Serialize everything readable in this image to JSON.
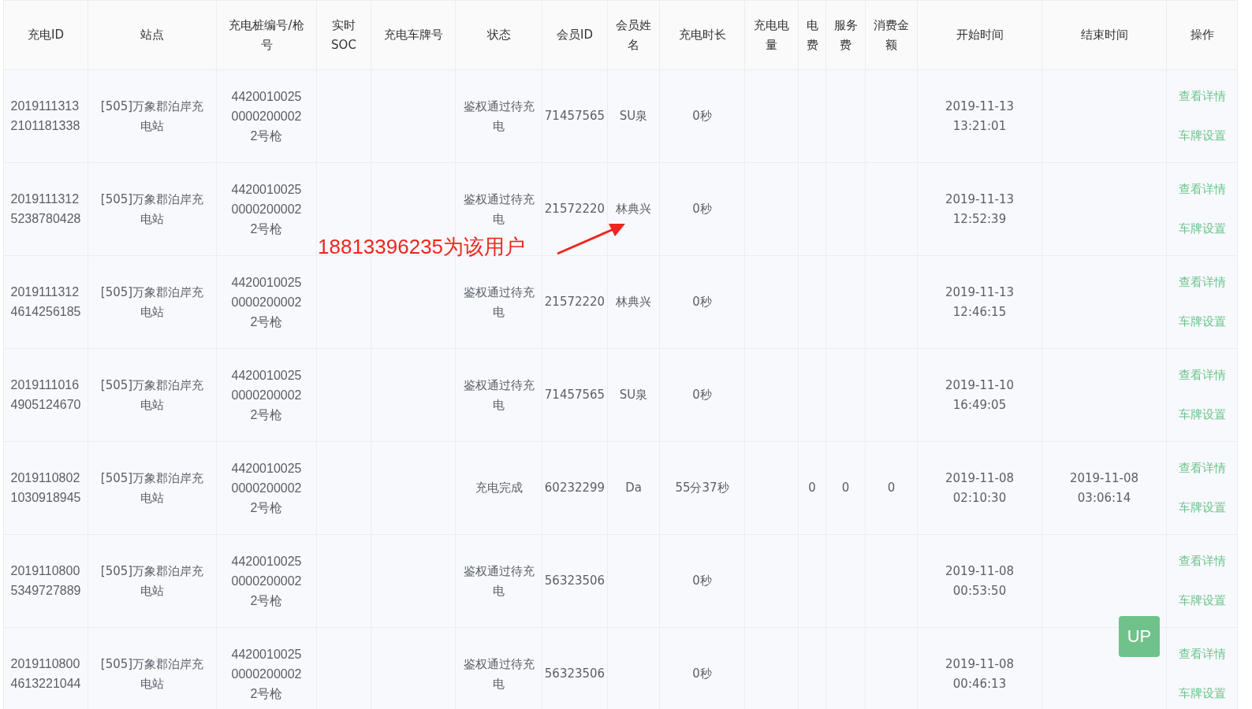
{
  "table": {
    "columns": [
      "充电ID",
      "站点",
      "充电桩编号/枪号",
      "实时SOC",
      "充电车牌号",
      "状态",
      "会员ID",
      "会员姓名",
      "充电时长",
      "充电电量",
      "电费",
      "服务费",
      "消费金额",
      "开始时间",
      "结束时间",
      "操作"
    ],
    "rows": [
      {
        "charge_id": "20191113132101181338",
        "station": "[505]万象郡泊岸充电站",
        "pile": "44200100250000200002 2号枪",
        "status": "鉴权通过待充电",
        "member_id": "71457565",
        "member_name": "SU泉",
        "duration": "0秒",
        "start_time": "2019-11-13 13:21:01",
        "actions": [
          "查看详情",
          "车牌设置"
        ]
      },
      {
        "charge_id": "20191113125238780428",
        "station": "[505]万象郡泊岸充电站",
        "pile": "44200100250000200002 2号枪",
        "status": "鉴权通过待充电",
        "member_id": "21572220",
        "member_name": "林典兴",
        "duration": "0秒",
        "start_time": "2019-11-13 12:52:39",
        "actions": [
          "查看详情",
          "车牌设置"
        ]
      },
      {
        "charge_id": "20191113124614256185",
        "station": "[505]万象郡泊岸充电站",
        "pile": "44200100250000200002 2号枪",
        "status": "鉴权通过待充电",
        "member_id": "21572220",
        "member_name": "林典兴",
        "duration": "0秒",
        "start_time": "2019-11-13 12:46:15",
        "actions": [
          "查看详情",
          "车牌设置"
        ]
      },
      {
        "charge_id": "20191110164905124670",
        "station": "[505]万象郡泊岸充电站",
        "pile": "44200100250000200002 2号枪",
        "status": "鉴权通过待充电",
        "member_id": "71457565",
        "member_name": "SU泉",
        "duration": "0秒",
        "start_time": "2019-11-10 16:49:05",
        "actions": [
          "查看详情",
          "车牌设置"
        ]
      },
      {
        "charge_id": "20191108021030918945",
        "station": "[505]万象郡泊岸充电站",
        "pile": "44200100250000200002 2号枪",
        "status": "充电完成",
        "member_id": "60232299",
        "member_name": "Da",
        "duration": "55分37秒",
        "power_fee": "0",
        "service_fee": "0",
        "amount": "0",
        "start_time": "2019-11-08 02:10:30",
        "end_time": "2019-11-08 03:06:14",
        "actions": [
          "查看详情",
          "车牌设置"
        ]
      },
      {
        "charge_id": "20191108005349727889",
        "station": "[505]万象郡泊岸充电站",
        "pile": "44200100250000200002 2号枪",
        "status": "鉴权通过待充电",
        "member_id": "56323506",
        "duration": "0秒",
        "start_time": "2019-11-08 00:53:50",
        "actions": [
          "查看详情",
          "车牌设置"
        ]
      },
      {
        "charge_id": "20191108004613221044",
        "station": "[505]万象郡泊岸充电站",
        "pile": "44200100250000200002 2号枪",
        "status": "鉴权通过待充电",
        "member_id": "56323506",
        "duration": "0秒",
        "start_time": "2019-11-08 00:46:13",
        "actions": [
          "查看详情",
          "车牌设置"
        ]
      }
    ]
  },
  "annotation": {
    "text": "18813396235为该用户"
  },
  "up_button": {
    "label": "UP"
  }
}
